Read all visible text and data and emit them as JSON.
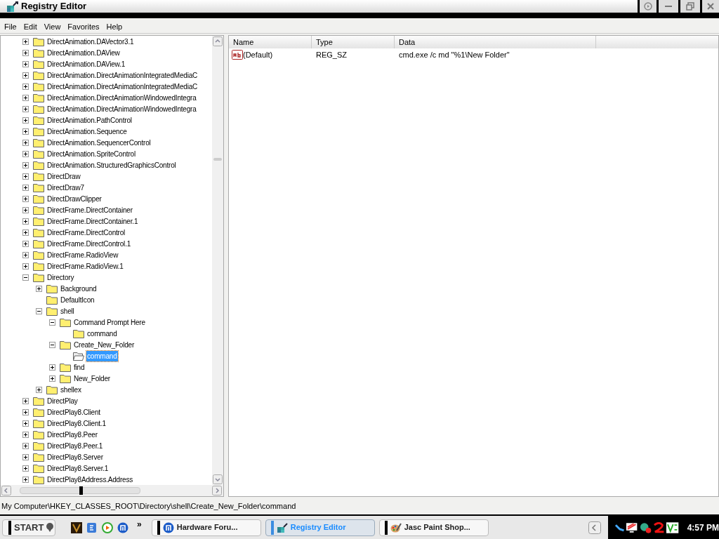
{
  "window": {
    "title": "Registry Editor"
  },
  "menu": [
    "File",
    "Edit",
    "View",
    "Favorites",
    "Help"
  ],
  "tree": [
    {
      "label": "DirectAnimation.DAVector3.1",
      "expanded": false,
      "selected": false
    },
    {
      "label": "DirectAnimation.DAView",
      "expanded": false,
      "selected": false
    },
    {
      "label": "DirectAnimation.DAView.1",
      "expanded": false,
      "selected": false
    },
    {
      "label": "DirectAnimation.DirectAnimationIntegratedMediaC",
      "expanded": false,
      "selected": false
    },
    {
      "label": "DirectAnimation.DirectAnimationIntegratedMediaC",
      "expanded": false,
      "selected": false
    },
    {
      "label": "DirectAnimation.DirectAnimationWindowedIntegra",
      "expanded": false,
      "selected": false
    },
    {
      "label": "DirectAnimation.DirectAnimationWindowedIntegra",
      "expanded": false,
      "selected": false
    },
    {
      "label": "DirectAnimation.PathControl",
      "expanded": false,
      "selected": false
    },
    {
      "label": "DirectAnimation.Sequence",
      "expanded": false,
      "selected": false
    },
    {
      "label": "DirectAnimation.SequencerControl",
      "expanded": false,
      "selected": false
    },
    {
      "label": "DirectAnimation.SpriteControl",
      "expanded": false,
      "selected": false
    },
    {
      "label": "DirectAnimation.StructuredGraphicsControl",
      "expanded": false,
      "selected": false
    },
    {
      "label": "DirectDraw",
      "expanded": false,
      "selected": false
    },
    {
      "label": "DirectDraw7",
      "expanded": false,
      "selected": false
    },
    {
      "label": "DirectDrawClipper",
      "expanded": false,
      "selected": false
    },
    {
      "label": "DirectFrame.DirectContainer",
      "expanded": false,
      "selected": false
    },
    {
      "label": "DirectFrame.DirectContainer.1",
      "expanded": false,
      "selected": false
    },
    {
      "label": "DirectFrame.DirectControl",
      "expanded": false,
      "selected": false
    },
    {
      "label": "DirectFrame.DirectControl.1",
      "expanded": false,
      "selected": false
    },
    {
      "label": "DirectFrame.RadioView",
      "expanded": false,
      "selected": false
    },
    {
      "label": "DirectFrame.RadioView.1",
      "expanded": false,
      "selected": false
    },
    {
      "label": "Directory",
      "expanded": true,
      "selected": false,
      "children": [
        {
          "label": "Background",
          "expanded": false,
          "selected": false
        },
        {
          "label": "DefaultIcon",
          "selected": false
        },
        {
          "label": "shell",
          "expanded": true,
          "selected": false,
          "children": [
            {
              "label": "Command Prompt Here",
              "expanded": true,
              "selected": false,
              "children": [
                {
                  "label": "command",
                  "selected": false
                }
              ]
            },
            {
              "label": "Create_New_Folder",
              "expanded": true,
              "selected": false,
              "children": [
                {
                  "label": "command",
                  "selected": true
                }
              ]
            },
            {
              "label": "find",
              "expanded": false,
              "selected": false
            },
            {
              "label": "New_Folder",
              "expanded": false,
              "selected": false
            }
          ]
        },
        {
          "label": "shellex",
          "expanded": false,
          "selected": false
        }
      ]
    },
    {
      "label": "DirectPlay",
      "expanded": false,
      "selected": false
    },
    {
      "label": "DirectPlay8.Client",
      "expanded": false,
      "selected": false
    },
    {
      "label": "DirectPlay8.Client.1",
      "expanded": false,
      "selected": false
    },
    {
      "label": "DirectPlay8.Peer",
      "expanded": false,
      "selected": false
    },
    {
      "label": "DirectPlay8.Peer.1",
      "expanded": false,
      "selected": false
    },
    {
      "label": "DirectPlay8.Server",
      "expanded": false,
      "selected": false
    },
    {
      "label": "DirectPlay8.Server.1",
      "expanded": false,
      "selected": false
    },
    {
      "label": "DirectPlay8Address.Address",
      "expanded": false,
      "selected": false
    }
  ],
  "values": {
    "columns": [
      "Name",
      "Type",
      "Data"
    ],
    "rows": [
      {
        "name": "(Default)",
        "type": "REG_SZ",
        "data": "cmd.exe /c md \"%1\\New Folder\""
      }
    ]
  },
  "status_bar": "My Computer\\HKEY_CLASSES_ROOT\\Directory\\shell\\Create_New_Folder\\command",
  "taskbar": {
    "start": "START",
    "more": "»",
    "tasks": [
      {
        "label": "Hardware Foru...",
        "selected": false
      },
      {
        "label": "Registry Editor",
        "selected": true
      },
      {
        "label": "Jasc Paint Shop...",
        "selected": false
      }
    ],
    "clock": "4:57 PM"
  }
}
